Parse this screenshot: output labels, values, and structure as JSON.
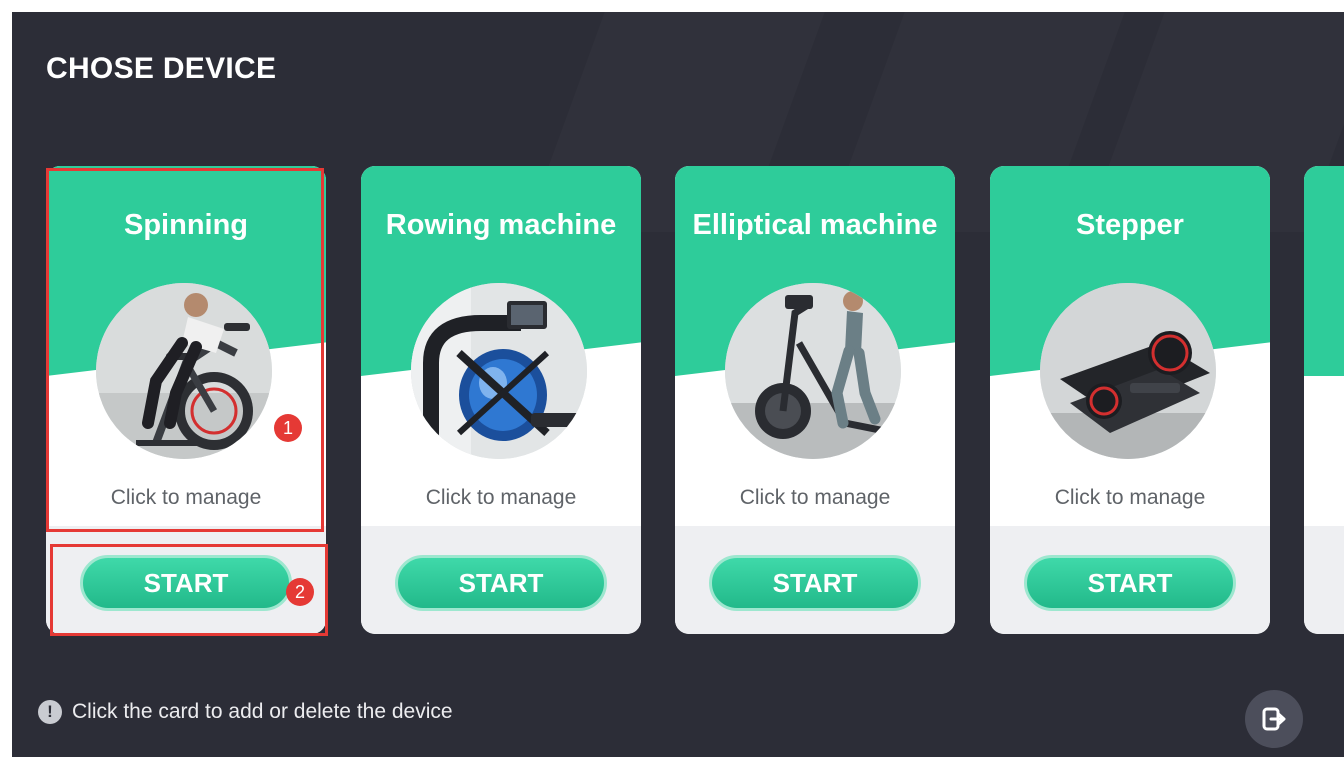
{
  "header": {
    "title": "CHOSE DEVICE"
  },
  "devices": [
    {
      "name": "Spinning",
      "manage_label": "Click to manage",
      "start_label": "START"
    },
    {
      "name": "Rowing machine",
      "manage_label": "Click to manage",
      "start_label": "START"
    },
    {
      "name": "Elliptical machine",
      "manage_label": "Click to manage",
      "start_label": "START"
    },
    {
      "name": "Stepper",
      "manage_label": "Click to manage",
      "start_label": "START"
    }
  ],
  "annotations": {
    "badge_1": "1",
    "badge_2": "2"
  },
  "footer": {
    "hint_text": "Click the card to add or delete the device",
    "hint_icon": "!"
  },
  "icons": {
    "hint": "info-icon",
    "exit": "exit-icon"
  },
  "colors": {
    "accent": "#2ecc9a",
    "background": "#2c2d37",
    "highlight": "#e53935"
  }
}
